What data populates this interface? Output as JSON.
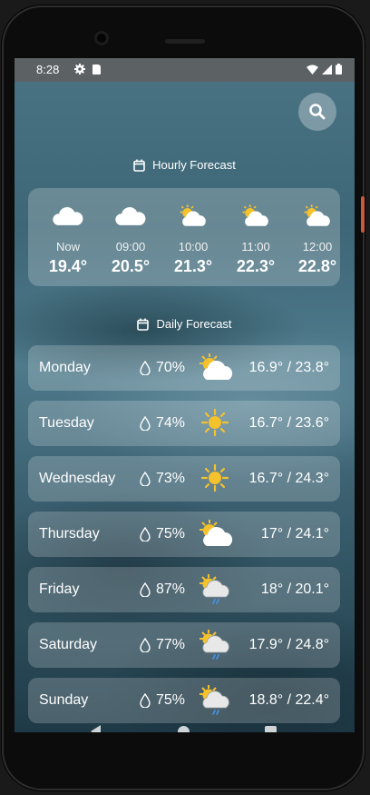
{
  "status_bar": {
    "time": "8:28"
  },
  "hourly": {
    "title": "Hourly Forecast",
    "items": [
      {
        "label": "Now",
        "temp": "19.4°",
        "icon": "cloud-icon"
      },
      {
        "label": "09:00",
        "temp": "20.5°",
        "icon": "cloud-icon"
      },
      {
        "label": "10:00",
        "temp": "21.3°",
        "icon": "partly-cloudy-icon"
      },
      {
        "label": "11:00",
        "temp": "22.3°",
        "icon": "partly-cloudy-icon"
      },
      {
        "label": "12:00",
        "temp": "22.8°",
        "icon": "partly-cloudy-icon"
      }
    ]
  },
  "daily": {
    "title": "Daily Forecast",
    "days": [
      {
        "name": "Monday",
        "humidity": "70%",
        "range": "16.9° / 23.8°",
        "icon": "partly-cloudy-icon"
      },
      {
        "name": "Tuesday",
        "humidity": "74%",
        "range": "16.7° / 23.6°",
        "icon": "sun-icon"
      },
      {
        "name": "Wednesday",
        "humidity": "73%",
        "range": "16.7° / 24.3°",
        "icon": "sun-icon"
      },
      {
        "name": "Thursday",
        "humidity": "75%",
        "range": "17° / 24.1°",
        "icon": "partly-cloudy-icon"
      },
      {
        "name": "Friday",
        "humidity": "87%",
        "range": "18° / 20.1°",
        "icon": "rain-icon"
      },
      {
        "name": "Saturday",
        "humidity": "77%",
        "range": "17.9° / 24.8°",
        "icon": "rain-icon"
      },
      {
        "name": "Sunday",
        "humidity": "75%",
        "range": "18.8° / 22.4°",
        "icon": "rain-icon"
      }
    ]
  },
  "colors": {
    "sun": "#f6c22c",
    "cloud": "#ffffff",
    "rain": "#4a8fe0",
    "card": "rgba(255,255,255,0.2)"
  }
}
